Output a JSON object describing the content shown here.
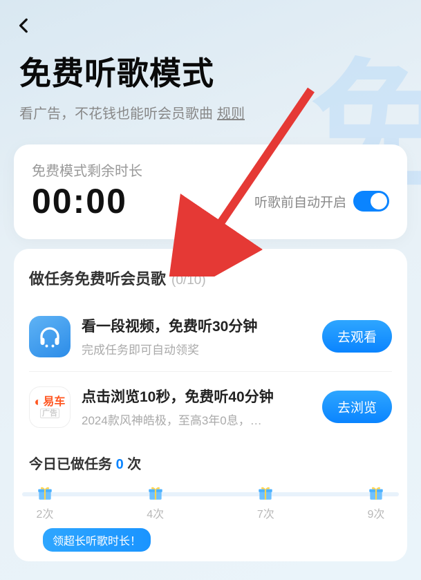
{
  "watermark": "免",
  "header": {
    "title": "免费听歌模式",
    "subtitle": "看广告，不花钱也能听会员歌曲",
    "rules_label": "规则"
  },
  "remaining": {
    "label": "免费模式剩余时长",
    "timer": "00:00",
    "auto_label": "听歌前自动开启"
  },
  "tasks": {
    "title": "做任务免费听会员歌",
    "count": "(0/10)",
    "items": [
      {
        "icon": "headphone",
        "title": "看一段视频，免费听30分钟",
        "desc": "完成任务即可自动领奖",
        "button": "去观看"
      },
      {
        "icon": "yiche",
        "icon_text": "易车",
        "ad_tag": "广告",
        "title": "点击浏览10秒，免费听40分钟",
        "desc": "2024款风神皓极，至高3年0息，…",
        "button": "去浏览"
      }
    ]
  },
  "done": {
    "prefix": "今日已做任务 ",
    "count": "0",
    "suffix": " 次"
  },
  "milestones": [
    "2次",
    "4次",
    "7次",
    "9次"
  ],
  "badge": "领超长听歌时长！"
}
